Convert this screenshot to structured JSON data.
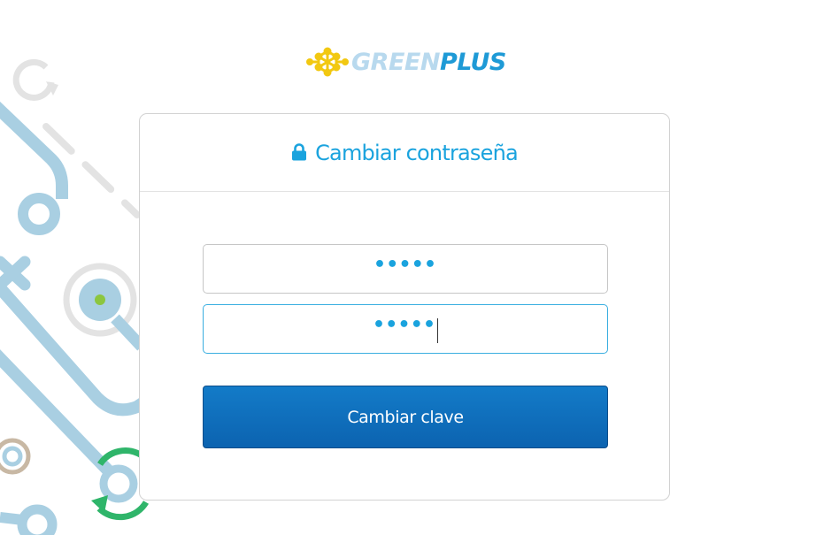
{
  "brand": {
    "logo_icon": "hexagon-molecule-icon",
    "name_part1": "GREEN",
    "name_part2": "PLUS",
    "colors": {
      "light": "#b8d9ee",
      "dark": "#1e9ad6",
      "mark": "#f2c811"
    }
  },
  "card": {
    "title": "Cambiar contraseña",
    "title_icon": "lock-icon",
    "password_field": {
      "value": "•••••"
    },
    "confirm_field": {
      "value": "•••••"
    },
    "submit_label": "Cambiar clave"
  },
  "colors": {
    "accent": "#1aa3de",
    "button": "#0c63b0",
    "decoration_blue": "#a9cfe2",
    "decoration_gray": "#e4e4e4",
    "decoration_green": "#2fb56a"
  }
}
